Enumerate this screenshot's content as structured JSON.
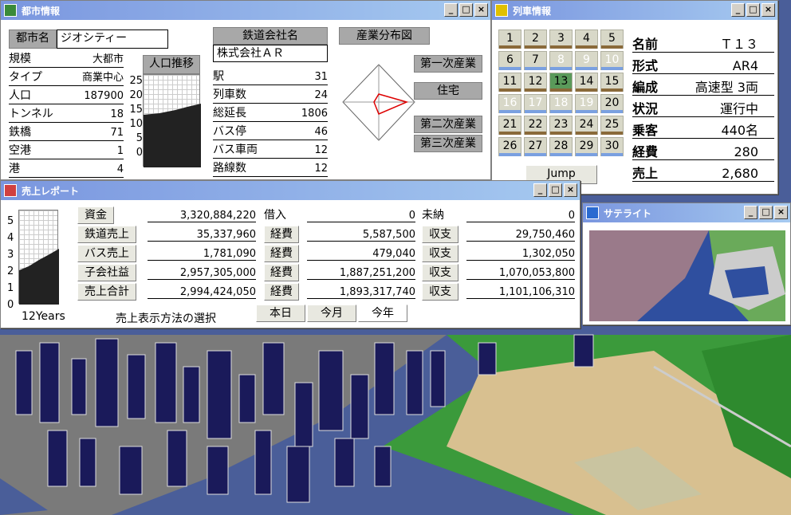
{
  "city": {
    "title": "都市情報",
    "name_label": "都市名",
    "name": "ジオシティー",
    "rows": [
      {
        "k": "規模",
        "v": "大都市"
      },
      {
        "k": "タイプ",
        "v": "商業中心"
      },
      {
        "k": "人口",
        "v": "187900"
      },
      {
        "k": "トンネル",
        "v": "18"
      },
      {
        "k": "鉄橋",
        "v": "71"
      },
      {
        "k": "空港",
        "v": "1"
      },
      {
        "k": "港",
        "v": "4"
      }
    ],
    "pop_label": "人口推移",
    "pop_ticks": [
      "25",
      "20",
      "15",
      "10",
      "5",
      "0"
    ],
    "company_label": "鉄道会社名",
    "company": "株式会社ＡＲ",
    "rail": [
      {
        "k": "駅",
        "v": "31"
      },
      {
        "k": "列車数",
        "v": "24"
      },
      {
        "k": "総延長",
        "v": "1806"
      },
      {
        "k": "バス停",
        "v": "46"
      },
      {
        "k": "バス車両",
        "v": "12"
      },
      {
        "k": "路線数",
        "v": "12"
      }
    ],
    "industry_label": "産業分布図",
    "industry": [
      "第一次産業",
      "住宅",
      "第二次産業",
      "第三次産業"
    ]
  },
  "train": {
    "title": "列車情報",
    "numbers": [
      "1",
      "2",
      "3",
      "4",
      "5",
      "6",
      "7",
      "8",
      "9",
      "10",
      "11",
      "12",
      "13",
      "14",
      "15",
      "16",
      "17",
      "18",
      "19",
      "20",
      "21",
      "22",
      "23",
      "24",
      "25",
      "26",
      "27",
      "28",
      "29",
      "30"
    ],
    "jump": "Jump",
    "info": [
      {
        "k": "名前",
        "v": "Ｔ１３"
      },
      {
        "k": "形式",
        "v": "AR4"
      },
      {
        "k": "編成",
        "v": "高速型 3両"
      },
      {
        "k": "状況",
        "v": "運行中"
      },
      {
        "k": "乗客",
        "v": "440名"
      },
      {
        "k": "経費",
        "v": "280"
      },
      {
        "k": "売上",
        "v": "2,680"
      }
    ]
  },
  "sales": {
    "title": "売上レポート",
    "years": "12Years",
    "ticks": [
      "5",
      "4",
      "3",
      "2",
      "1",
      "0"
    ],
    "rows": [
      {
        "label": "資金",
        "value": "3,320,884,220",
        "mid": "借入",
        "mid_value": "0",
        "right": "未納",
        "right_value": "0"
      },
      {
        "label": "鉄道売上",
        "value": "35,337,960",
        "mid": "経費",
        "mid_value": "5,587,500",
        "right": "収支",
        "right_value": "29,750,460"
      },
      {
        "label": "バス売上",
        "value": "1,781,090",
        "mid": "経費",
        "mid_value": "479,040",
        "right": "収支",
        "right_value": "1,302,050"
      },
      {
        "label": "子会社益",
        "value": "2,957,305,000",
        "mid": "経費",
        "mid_value": "1,887,251,200",
        "right": "収支",
        "right_value": "1,070,053,800"
      },
      {
        "label": "売上合計",
        "value": "2,994,424,050",
        "mid": "経費",
        "mid_value": "1,893,317,740",
        "right": "収支",
        "right_value": "1,101,106,310"
      }
    ],
    "select_label": "売上表示方法の選択",
    "tabs": [
      "本日",
      "今月",
      "今年"
    ]
  },
  "satellite": {
    "title": "サテライト"
  },
  "window_buttons": {
    "min": "_",
    "max": "□",
    "close": "×"
  }
}
